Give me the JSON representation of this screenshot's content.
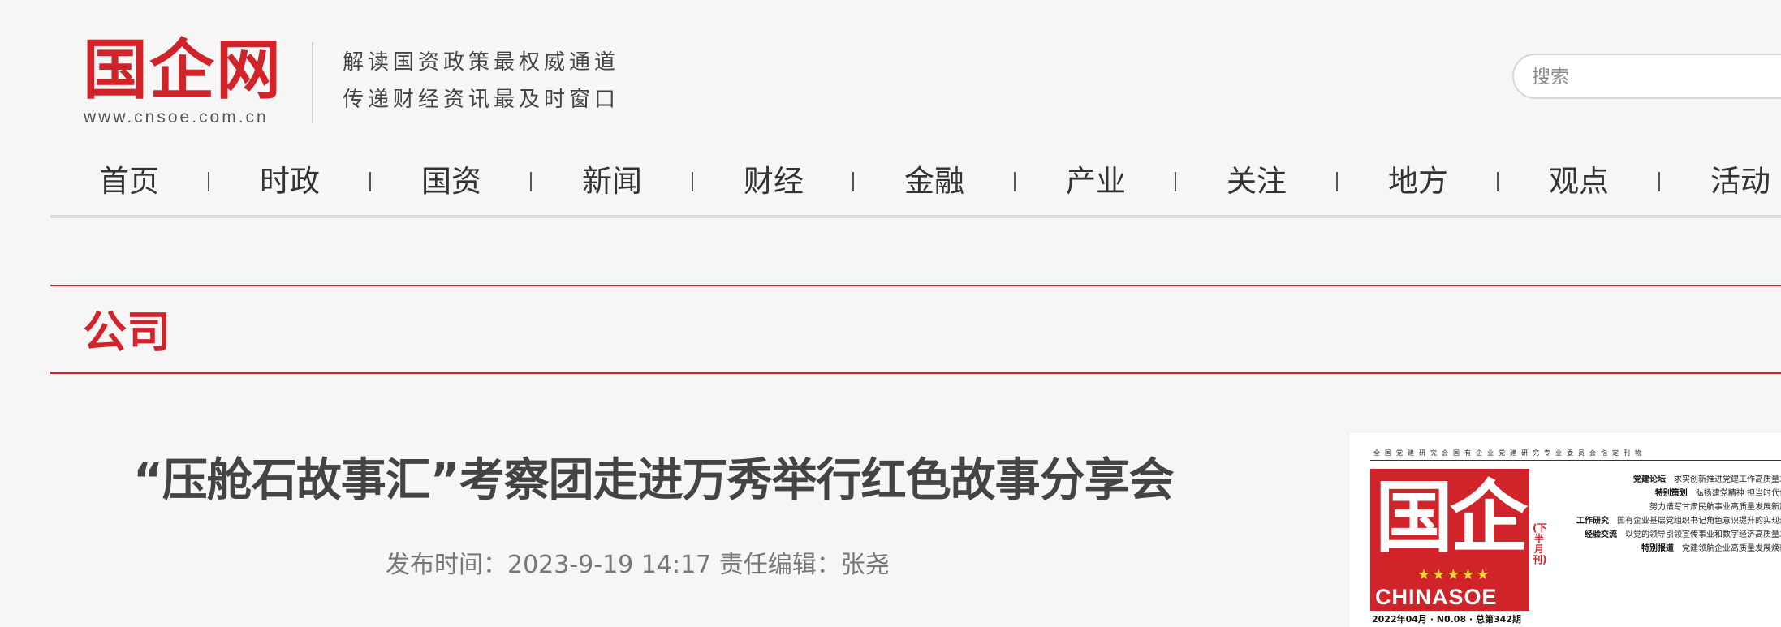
{
  "header": {
    "logo_text": "国企网",
    "logo_url": "www.cnsoe.com.cn",
    "slogan_line1": "解读国资政策最权威通道",
    "slogan_line2": "传递财经资讯最及时窗口",
    "search_placeholder": "搜索"
  },
  "nav": {
    "items": [
      "首页",
      "时政",
      "国资",
      "新闻",
      "财经",
      "金融",
      "产业",
      "关注",
      "地方",
      "观点",
      "活动"
    ]
  },
  "section": {
    "title": "公司"
  },
  "article": {
    "title": "“压舱石故事汇”考察团走进万秀举行红色故事分享会",
    "meta": "发布时间：2023-9-19 14:17 责任编辑：张尧"
  },
  "magazine": {
    "top_line": "全国党建研究会国有企业党建研究专业委员会指定刊物",
    "logo_cn": "国企",
    "logo_en": "CHINASOE",
    "vertical_label": "(下半月刊)",
    "issue": "2022年04月 · N0.08 · 总第342期",
    "lines": [
      {
        "tag": "党建论坛",
        "text": "求实创新推进党建工作高质量发展"
      },
      {
        "tag": "特别策划",
        "text": "弘扬建党精神 担当时代使命"
      },
      {
        "tag": "",
        "text": "努力谱写甘肃民航事业高质量发展新篇章"
      },
      {
        "tag": "工作研究",
        "text": "国有企业基层党组织书记角色意识提升的实现途径"
      },
      {
        "tag": "经验交流",
        "text": "以党的领导引领宣传事业和数字经济高质量发展"
      },
      {
        "tag": "特别报道",
        "text": "党建领航企业高质量发展焕新彩"
      }
    ]
  },
  "colors": {
    "brand_red": "#d1242a",
    "background": "#f6f6f6"
  }
}
